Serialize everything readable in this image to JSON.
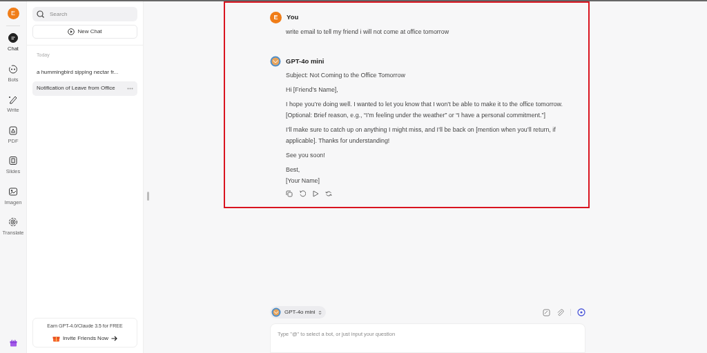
{
  "rail": {
    "avatar": "E",
    "items": [
      {
        "kind": "chat",
        "label": "Chat",
        "selected": true
      },
      {
        "kind": "bots",
        "label": "Bots",
        "selected": false
      },
      {
        "kind": "write",
        "label": "Write",
        "selected": false
      },
      {
        "kind": "pdf",
        "label": "PDF",
        "selected": false
      },
      {
        "kind": "slides",
        "label": "Slides",
        "selected": false
      },
      {
        "kind": "imagen",
        "label": "Imagen",
        "selected": false
      },
      {
        "kind": "translate",
        "label": "Translate",
        "selected": false
      }
    ]
  },
  "sidebar": {
    "search": {
      "placeholder": "Search"
    },
    "new_chat": "New Chat",
    "section": "Today",
    "chats": [
      {
        "title": "a hummingbird sipping nectar fr...",
        "selected": false
      },
      {
        "title": "Notification of Leave from Office",
        "selected": true
      }
    ],
    "promo": {
      "text": "Earn GPT-4.0/Claude 3.5 for FREE",
      "button": "Invite Friends Now"
    }
  },
  "messages": [
    {
      "kind": "user",
      "author": "You",
      "avatar": "E",
      "paragraphs": [
        "write email to tell my friend i will not come at office tomorrow"
      ]
    },
    {
      "kind": "bot",
      "author": "GPT-4o mini",
      "paragraphs": [
        "Subject: Not Coming to the Office Tomorrow",
        "Hi [Friend’s Name],",
        "I hope you’re doing well. I wanted to let you know that I won’t be able to make it to the office tomorrow. [Optional: Brief reason, e.g., “I’m feeling under the weather” or “I have a personal commitment.”]",
        "I’ll make sure to catch up on anything I might miss, and I’ll be back on [mention when you’ll return, if applicable]. Thanks for understanding!",
        "See you soon!",
        "Best,\n[Your Name]"
      ]
    }
  ],
  "composer": {
    "model": "GPT-4o mini",
    "placeholder": "Type \"@\" to select a bot, or just input your question"
  }
}
